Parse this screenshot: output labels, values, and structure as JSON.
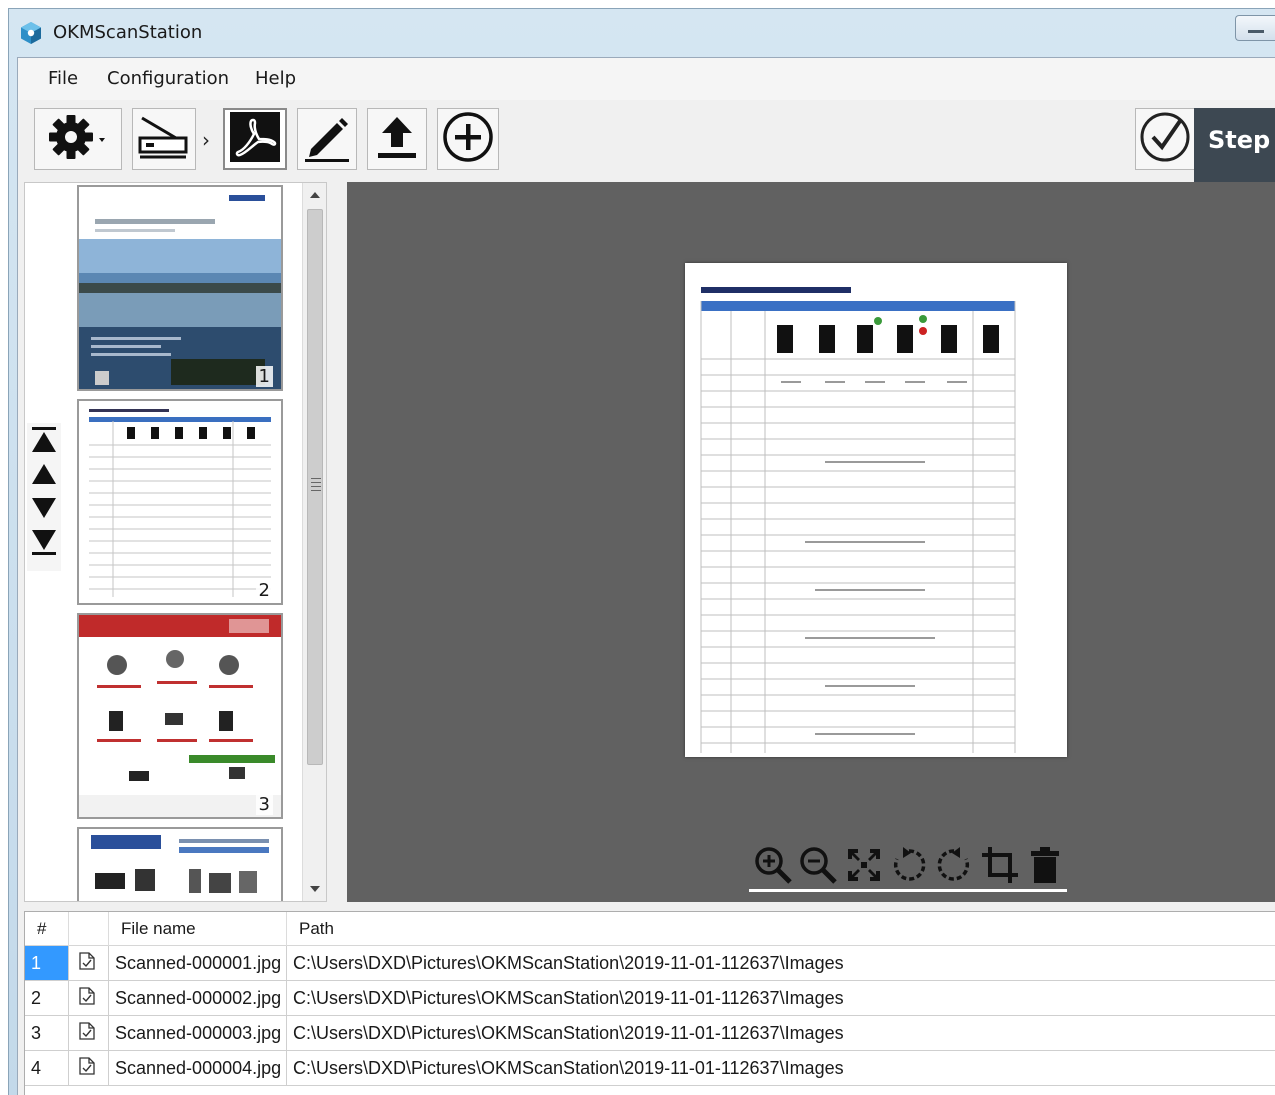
{
  "app": {
    "title": "OKMScanStation",
    "step_label": "Step"
  },
  "menu": {
    "items": [
      {
        "label": "File"
      },
      {
        "label": "Configuration"
      },
      {
        "label": "Help"
      }
    ]
  },
  "toolbar": {
    "buttons": [
      {
        "icon": "gear-icon"
      },
      {
        "icon": "scanner-icon"
      },
      {
        "icon": "pdf-icon",
        "active": true
      },
      {
        "icon": "pencil-icon"
      },
      {
        "icon": "upload-icon"
      },
      {
        "icon": "add-circle-icon"
      }
    ],
    "separator": "›",
    "confirm_icon": "check-circle-icon"
  },
  "thumbnails": [
    {
      "page": "1"
    },
    {
      "page": "2"
    },
    {
      "page": "3"
    },
    {
      "page": ""
    }
  ],
  "nav": {
    "icons": [
      "first-page-icon",
      "prev-page-icon",
      "next-page-icon",
      "last-page-icon"
    ]
  },
  "viewer": {
    "tools": [
      "zoom-in-icon",
      "zoom-out-icon",
      "fit-icon",
      "rotate-left-icon",
      "rotate-right-icon",
      "crop-icon",
      "trash-icon"
    ]
  },
  "file_list": {
    "headers": {
      "num": "#",
      "icon": "",
      "name": "File name",
      "path": "Path"
    },
    "rows": [
      {
        "num": "1",
        "name": "Scanned-000001.jpg",
        "path": "C:\\Users\\DXD\\Pictures\\OKMScanStation\\2019-11-01-112637\\Images",
        "selected": true
      },
      {
        "num": "2",
        "name": "Scanned-000002.jpg",
        "path": "C:\\Users\\DXD\\Pictures\\OKMScanStation\\2019-11-01-112637\\Images",
        "selected": false
      },
      {
        "num": "3",
        "name": "Scanned-000003.jpg",
        "path": "C:\\Users\\DXD\\Pictures\\OKMScanStation\\2019-11-01-112637\\Images",
        "selected": false
      },
      {
        "num": "4",
        "name": "Scanned-000004.jpg",
        "path": "C:\\Users\\DXD\\Pictures\\OKMScanStation\\2019-11-01-112637\\Images",
        "selected": false
      }
    ]
  },
  "colors": {
    "selection": "#3399ff",
    "viewer_bg": "#616161",
    "step_panel": "#3d4852"
  }
}
